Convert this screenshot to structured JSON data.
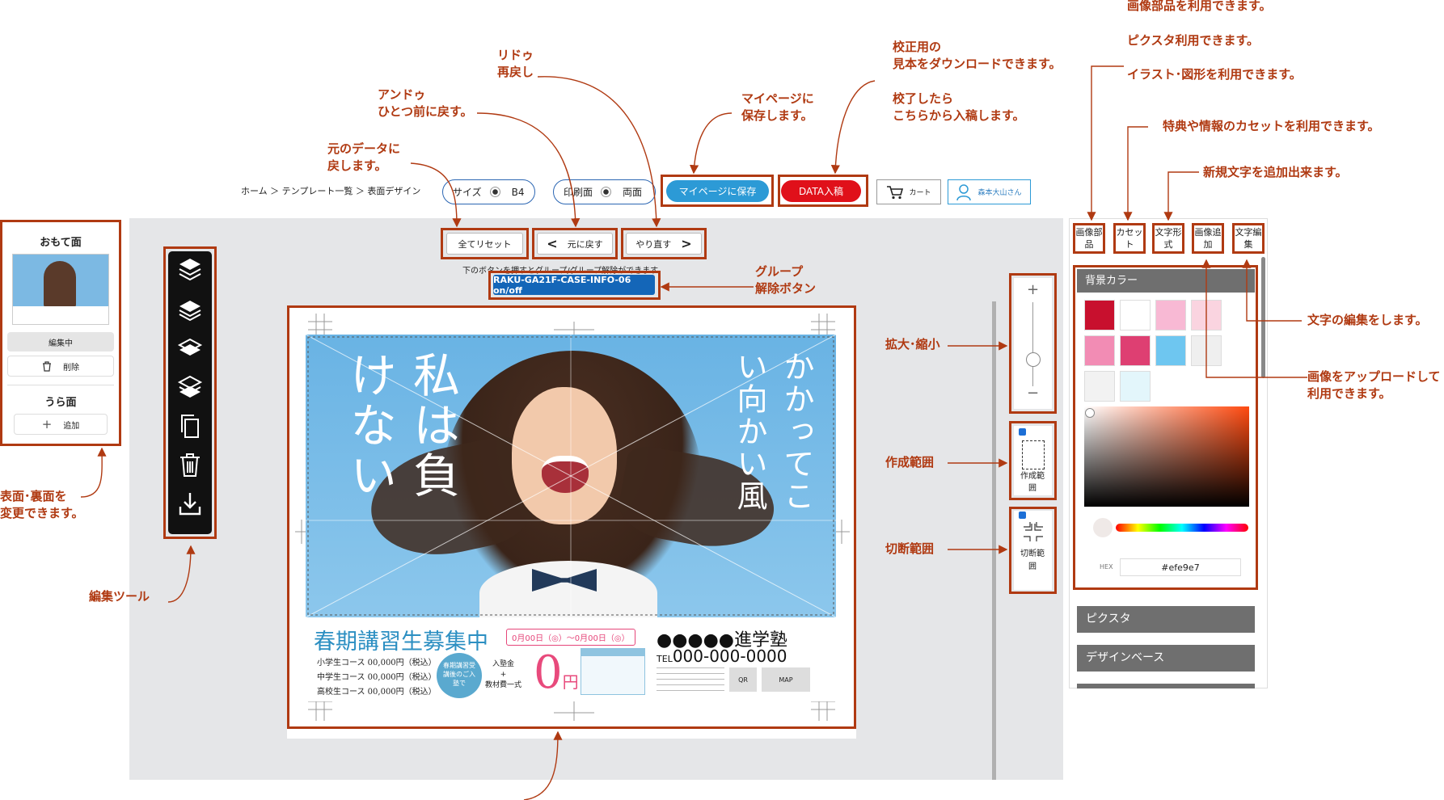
{
  "breadcrumb": "ホーム ＞ テンプレート一覧 ＞ 表面デザイン",
  "header": {
    "size_label": "サイズ",
    "size_value": "B4",
    "print_label": "印刷面",
    "print_value": "両面",
    "save_button": "マイページに保存",
    "data_button": "DATA入稿",
    "cart_label": "カート",
    "user_label": "森本大山さん"
  },
  "toolbar": {
    "reset": "全てリセット",
    "undo": "元に戻す",
    "redo": "やり直す",
    "hint": "下のボタンを押すとグループ/グループ解除ができます。",
    "group_button": "RAKU-GA21F-CASE-INFO-06 on/off"
  },
  "left_panel": {
    "front_title": "おもて面",
    "editing": "編集中",
    "delete": "削除",
    "back_title": "うら面",
    "add": "追加"
  },
  "flyer": {
    "headline_left": "私は負けない",
    "headline_right": "かかってこい向かい風",
    "recruit": "春期講習生募集中",
    "dates": "0月00日（◎）〜0月00日（◎）",
    "school": "●●●●●進学塾",
    "tel": "000-000-0000",
    "course1": "小学生コース 00,000円（税込）",
    "course2": "中学生コース 00,000円（税込）",
    "course3": "高校生コース 00,000円（税込）",
    "circle_text": "春期講習受講後のご入塾で",
    "fee1": "入塾金",
    "fee2": "教材費一式",
    "zero": "0",
    "yen": "円",
    "qr": "QR",
    "map": "MAP"
  },
  "side_controls": {
    "create_area": "作成範囲",
    "cut_area": "切断範囲"
  },
  "right_panel": {
    "tabs": [
      "画像部品",
      "カセット",
      "文字形式",
      "画像追加",
      "文字編集"
    ],
    "bg_color_title": "背景カラー",
    "swatches": [
      "#c8102e",
      "#ffffff",
      "#f8b9d4",
      "#fad4e0",
      "#f28cb4",
      "#de3f72",
      "#6ec6f0",
      "#efefef",
      "#f2f2f2",
      "#e3f6fb"
    ],
    "hex_label": "HEX",
    "hex_value": "#efe9e7",
    "pictogram": "ピクスタ",
    "design_base": "デザインベース"
  },
  "annotations": {
    "reset": "元のデータに\n戻します。",
    "undo": "アンドゥ\nひとつ前に戻す。",
    "redo": "リドゥ\n再戻し",
    "save": "マイページに\n保存します。",
    "proof": "校正用の\n見本をダウンロードできます。",
    "submit": "校了したら\nこちらから入稿します。",
    "image_parts": "画像部品を利用できます。",
    "pixta": "ピクスタ利用できます。",
    "illust": "イラスト･図形を利用できます。",
    "cassette": "特典や情報のカセットを利用できます。",
    "new_text": "新規文字を追加出来ます。",
    "group": "グループ\n解除ボタン",
    "zoom": "拡大･縮小",
    "create_area": "作成範囲",
    "cut_area": "切断範囲",
    "text_edit": "文字の編集をします。",
    "image_upload": "画像をアップロードして\n利用できます。",
    "side_switch": "表面･裏面を\n変更できます。",
    "edit_tools": "編集ツール"
  },
  "colors": {
    "accent_red": "#b03a12",
    "save_blue": "#2c9ad6",
    "data_red": "#e0101a",
    "group_blue": "#1466b8",
    "sky": "#7cb9e3"
  }
}
